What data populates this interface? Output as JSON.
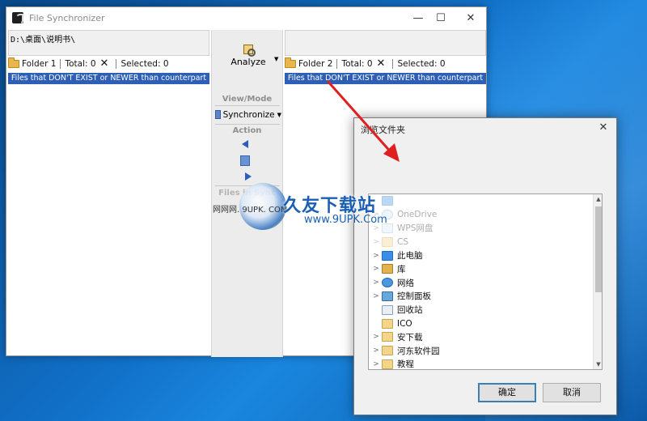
{
  "main_window": {
    "title": "File Synchronizer",
    "controls": {
      "minimize": "—",
      "maximize": "☐",
      "close": "✕"
    },
    "left_pane": {
      "path": "D:\\桌面\\说明书\\",
      "folder_label": "Folder 1",
      "total_label": "Total: 0",
      "selected_label": "Selected: 0",
      "filter": "Files that DON'T EXIST or NEWER than counterpart"
    },
    "right_pane": {
      "path": "",
      "folder_label": "Folder 2",
      "total_label": "Total: 0",
      "selected_label": "Selected: 0",
      "filter": "Files that DON'T EXIST or NEWER than counterpart"
    },
    "toolbar": {
      "analyze_label": "Analyze",
      "view_mode_label": "View/Mode",
      "synchronize_label": "Synchronize",
      "action_label": "Action",
      "files_label": "Files in Sync"
    }
  },
  "dialog": {
    "title": "浏览文件夹",
    "close": "✕",
    "tree_items": [
      {
        "label": "",
        "icon": "desktop-icon",
        "faded": true,
        "expander": ""
      },
      {
        "label": "OneDrive",
        "icon": "cloud-icon",
        "faded": true,
        "expander": ">"
      },
      {
        "label": "WPS网盘",
        "icon": "wps-drive-icon",
        "faded": true,
        "expander": ">"
      },
      {
        "label": "CS",
        "icon": "folder-icon",
        "faded": true,
        "expander": ">"
      },
      {
        "label": "此电脑",
        "icon": "computer-icon",
        "faded": false,
        "expander": ">"
      },
      {
        "label": "库",
        "icon": "library-icon",
        "faded": false,
        "expander": ">"
      },
      {
        "label": "网络",
        "icon": "network-icon",
        "faded": false,
        "expander": ">"
      },
      {
        "label": "控制面板",
        "icon": "control-panel-icon",
        "faded": false,
        "expander": ">"
      },
      {
        "label": "回收站",
        "icon": "recycle-bin-icon",
        "faded": false,
        "expander": ""
      },
      {
        "label": "ICO",
        "icon": "folder-icon",
        "faded": false,
        "expander": ""
      },
      {
        "label": "安下载",
        "icon": "folder-icon",
        "faded": false,
        "expander": ">"
      },
      {
        "label": "河东软件园",
        "icon": "folder-icon",
        "faded": false,
        "expander": ">"
      },
      {
        "label": "教程",
        "icon": "folder-icon",
        "faded": false,
        "expander": ">"
      }
    ],
    "scroll_up": "▲",
    "scroll_down": "▼",
    "ok_label": "确定",
    "cancel_label": "取消"
  },
  "watermark": {
    "title": "久友下载站",
    "url": "www.9UPK.Com",
    "small": "网网网. 9UPK. COM"
  },
  "colors": {
    "filter_bar": "#2e5fb6",
    "arrow": "#e02020",
    "desktop": "#1170c8"
  }
}
